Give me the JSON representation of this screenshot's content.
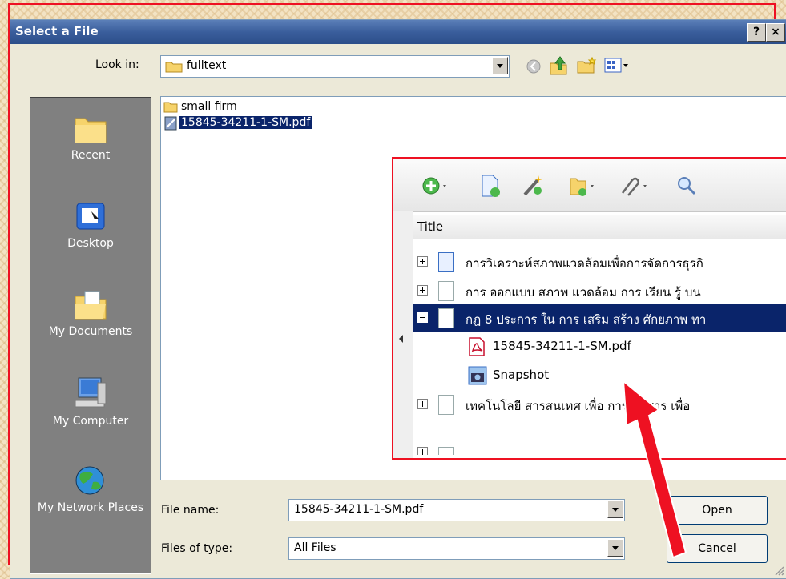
{
  "dialog": {
    "title": "Select a File",
    "help_button": "?",
    "close_button": "×"
  },
  "look_in": {
    "label": "Look in:",
    "value": "fulltext"
  },
  "places": [
    {
      "label": "Recent",
      "icon": "recent-folder-icon"
    },
    {
      "label": "Desktop",
      "icon": "desktop-icon"
    },
    {
      "label": "My Documents",
      "icon": "my-documents-icon"
    },
    {
      "label": "My Computer",
      "icon": "my-computer-icon"
    },
    {
      "label": "My Network Places",
      "icon": "network-places-icon"
    }
  ],
  "files": [
    {
      "name": "small firm",
      "icon": "folder-icon",
      "selected": false
    },
    {
      "name": "15845-34211-1-SM.pdf",
      "icon": "pdf-file-icon",
      "selected": true
    }
  ],
  "file_name": {
    "label": "File name:",
    "value": "15845-34211-1-SM.pdf"
  },
  "file_type": {
    "label": "Files of type:",
    "value": "All Files"
  },
  "buttons": {
    "open": "Open",
    "cancel": "Cancel"
  },
  "inset": {
    "column_title": "Title",
    "rows": [
      {
        "text": "การวิเคราะห์สภาพแวดล้อมเพื่อการจัดการธุรกิ",
        "expander": "plus",
        "selected": false
      },
      {
        "text": "การ ออกแบบ สภาพ แวดล้อม การ เรียน รู้ บน",
        "expander": "plus",
        "selected": false
      },
      {
        "text": "กฎ 8 ประการ ใน การ เสริม สร้าง ศักยภาพ ทา",
        "expander": "minus",
        "selected": true
      },
      {
        "text": "15845-34211-1-SM.pdf",
        "child": true,
        "icon": "pdf-icon"
      },
      {
        "text": "Snapshot",
        "child": true,
        "icon": "snapshot-icon"
      },
      {
        "text": "เทคโนโลยี สารสนเทศ เพื่อ การ สื่อสาร เพื่อ",
        "expander": "plus",
        "selected": false
      }
    ]
  },
  "annotation": {
    "arrow_color": "#ee1122"
  }
}
